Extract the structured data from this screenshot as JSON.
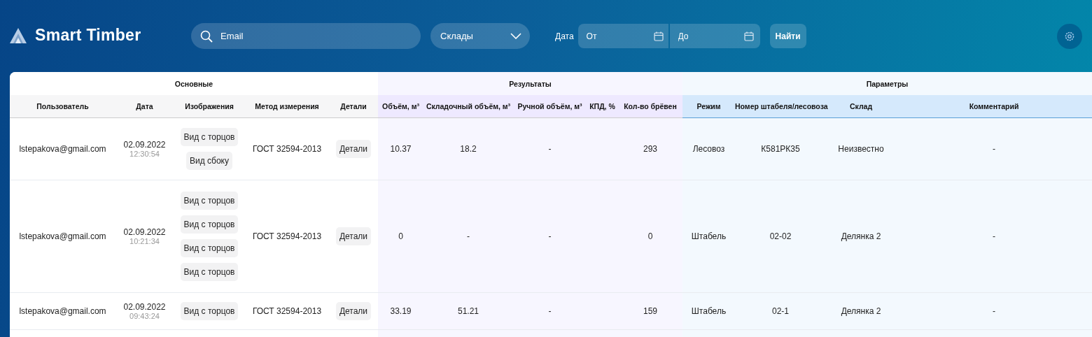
{
  "header": {
    "logo": "Smart Timber",
    "search": {
      "placeholder": "Email"
    },
    "warehouse_select": {
      "value": "Склады"
    },
    "date_label": "Дата",
    "date_from": {
      "placeholder": "От"
    },
    "date_to": {
      "placeholder": "До"
    },
    "find_button": "Найти"
  },
  "table": {
    "groups": [
      {
        "label": "Основные",
        "kind": "main"
      },
      {
        "label": "Результаты",
        "kind": "results"
      },
      {
        "label": "Параметры",
        "kind": "params"
      }
    ],
    "columns": [
      {
        "label": "Пользователь",
        "kind": "main"
      },
      {
        "label": "Дата",
        "kind": "main"
      },
      {
        "label": "Изображения",
        "kind": "main"
      },
      {
        "label": "Метод измерения",
        "kind": "main"
      },
      {
        "label": "Детали",
        "kind": "main"
      },
      {
        "label": "Объём, м³",
        "kind": "results"
      },
      {
        "label": "Складочный объём, м³",
        "kind": "results"
      },
      {
        "label": "Ручной объём, м³",
        "kind": "results"
      },
      {
        "label": "КПД, %",
        "kind": "results"
      },
      {
        "label": "Кол-во брёвен",
        "kind": "results"
      },
      {
        "label": "Режим",
        "kind": "params"
      },
      {
        "label": "Номер штабеля/лесовоза",
        "kind": "params"
      },
      {
        "label": "Склад",
        "kind": "params"
      },
      {
        "label": "Комментарий",
        "kind": "params"
      }
    ],
    "rows": [
      {
        "user": "lstepakova@gmail.com",
        "date": "02.09.2022",
        "time": "12:30:54",
        "images": [
          "Вид с торцов",
          "Вид сбоку"
        ],
        "method": "ГОСТ 32594-2013",
        "details": "Детали",
        "volume": "10.37",
        "stack_volume": "18.2",
        "manual_volume": "-",
        "logs": "293",
        "mode": "Лесовоз",
        "number": "К581РК35",
        "warehouse": "Неизвестно",
        "comment": "-"
      },
      {
        "user": "lstepakova@gmail.com",
        "date": "02.09.2022",
        "time": "10:21:34",
        "images": [
          "Вид с торцов",
          "Вид с торцов",
          "Вид с торцов",
          "Вид с торцов"
        ],
        "method": "ГОСТ 32594-2013",
        "details": "Детали",
        "volume": "0",
        "stack_volume": "-",
        "manual_volume": "-",
        "logs": "0",
        "mode": "Штабель",
        "number": "02-02",
        "warehouse": "Делянка 2",
        "comment": "-"
      },
      {
        "user": "lstepakova@gmail.com",
        "date": "02.09.2022",
        "time": "09:43:24",
        "images": [
          "Вид с торцов"
        ],
        "method": "ГОСТ 32594-2013",
        "details": "Детали",
        "volume": "33.19",
        "stack_volume": "51.21",
        "manual_volume": "-",
        "logs": "159",
        "mode": "Штабель",
        "number": "02-1",
        "warehouse": "Делянка 2",
        "comment": "-"
      }
    ]
  }
}
